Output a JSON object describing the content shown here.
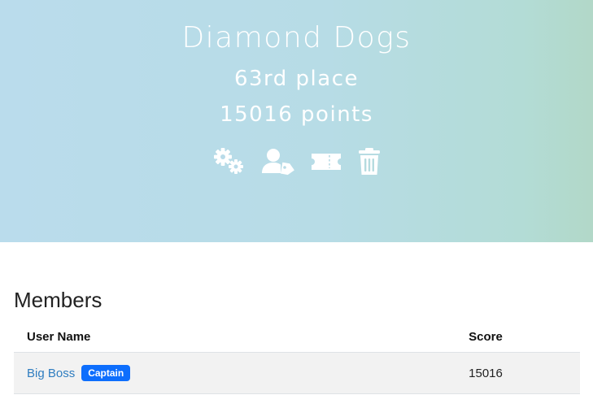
{
  "team": {
    "name": "Diamond Dogs",
    "place": "63rd place",
    "points": "15016 points"
  },
  "actions": [
    {
      "icon": "settings-gears-icon"
    },
    {
      "icon": "user-tag-icon"
    },
    {
      "icon": "ticket-icon"
    },
    {
      "icon": "trash-icon"
    }
  ],
  "members": {
    "title": "Members",
    "columns": {
      "user_name": "User Name",
      "score": "Score"
    },
    "rows": [
      {
        "user_name": "Big Boss",
        "badge": "Captain",
        "score": "15016"
      }
    ]
  },
  "colors": {
    "hero_gradient_start": "#badcec",
    "hero_gradient_end": "#b2d8c8",
    "link": "#2f7dc0",
    "badge": "#0d6efd",
    "row_background": "#f2f2f2"
  }
}
